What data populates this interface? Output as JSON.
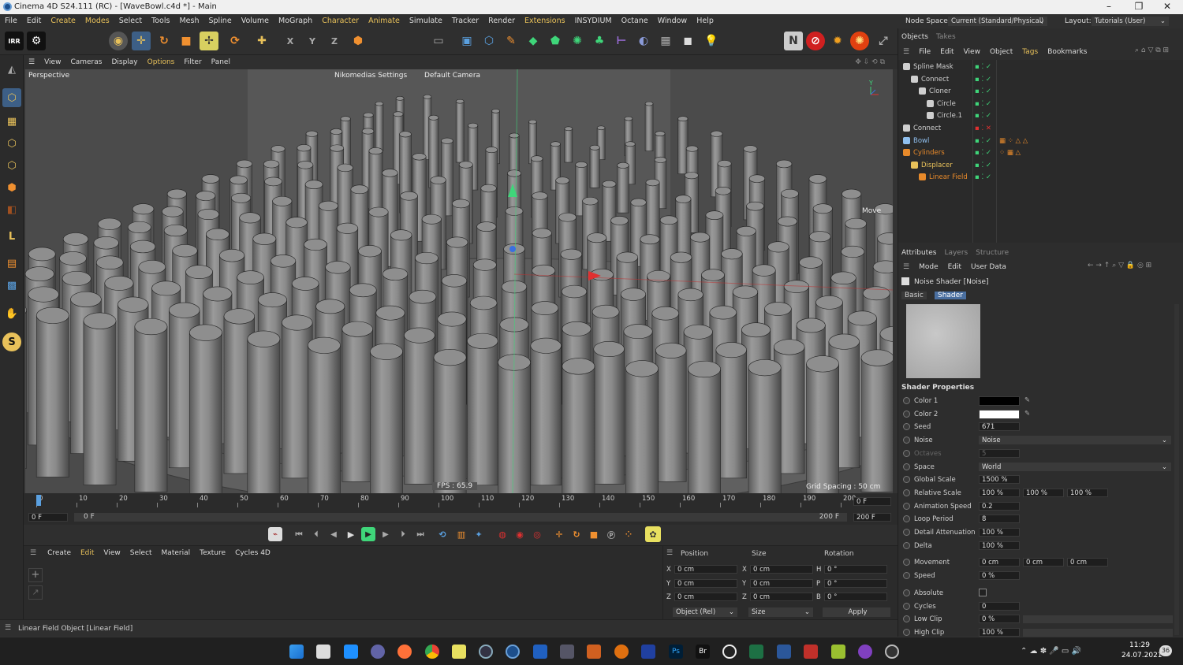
{
  "window": {
    "title": "Cinema 4D S24.111 (RC) - [WaveBowl.c4d *] - Main",
    "minimize": "–",
    "maximize": "❐",
    "close": "✕"
  },
  "menu": [
    "File",
    "Edit",
    "Create",
    "Modes",
    "Select",
    "Tools",
    "Mesh",
    "Spline",
    "Volume",
    "MoGraph",
    "Character",
    "Animate",
    "Simulate",
    "Tracker",
    "Render",
    "Extensions",
    "INSYDIUM",
    "Octane",
    "Window",
    "Help"
  ],
  "node_space": {
    "label": "Node Space:",
    "value": "Current (Standard/Physical)"
  },
  "layout": {
    "label": "Layout:",
    "value": "Tutorials (User)"
  },
  "viewport": {
    "menu": [
      "View",
      "Cameras",
      "Display",
      "Options",
      "Filter",
      "Panel"
    ],
    "name": "Perspective",
    "settings": "Nikomedias Settings",
    "camera": "Default Camera",
    "fps": "FPS : 65.9",
    "grid": "Grid Spacing : 50 cm",
    "move": "Move"
  },
  "timeline": {
    "ticks": [
      "0",
      "10",
      "20",
      "30",
      "40",
      "50",
      "60",
      "70",
      "80",
      "90",
      "100",
      "110",
      "120",
      "130",
      "140",
      "150",
      "160",
      "170",
      "180",
      "190",
      "200"
    ],
    "current": "0 F",
    "start": "0 F",
    "range_start": "0 F",
    "range_end": "200 F",
    "end": "200 F",
    "end2": "200 F"
  },
  "material_menu": [
    "Create",
    "Edit",
    "View",
    "Select",
    "Material",
    "Texture",
    "Cycles 4D"
  ],
  "coords": {
    "headers": [
      "Position",
      "Size",
      "Rotation"
    ],
    "rows": [
      {
        "axis": "X",
        "pos": "0 cm",
        "saxis": "X",
        "size": "0 cm",
        "raxis": "H",
        "rot": "0 °"
      },
      {
        "axis": "Y",
        "pos": "0 cm",
        "saxis": "Y",
        "size": "0 cm",
        "raxis": "P",
        "rot": "0 °"
      },
      {
        "axis": "Z",
        "pos": "0 cm",
        "saxis": "Z",
        "size": "0 cm",
        "raxis": "B",
        "rot": "0 °"
      }
    ],
    "mode": "Object (Rel)",
    "size_mode": "Size",
    "apply": "Apply"
  },
  "status": "Linear Field Object [Linear Field]",
  "objects_panel": {
    "tabs": [
      "Objects",
      "Takes"
    ],
    "menu": [
      "File",
      "Edit",
      "View",
      "Object",
      "Tags",
      "Bookmarks"
    ],
    "items": [
      {
        "name": "Spline Mask",
        "indent": 0,
        "color": "#cfcfcf",
        "icon": "spline-mask-icon"
      },
      {
        "name": "Connect",
        "indent": 1,
        "color": "#cfcfcf",
        "icon": "connect-icon"
      },
      {
        "name": "Cloner",
        "indent": 2,
        "color": "#cfcfcf",
        "icon": "cloner-icon"
      },
      {
        "name": "Circle",
        "indent": 3,
        "color": "#cfcfcf",
        "icon": "circle-spline-icon"
      },
      {
        "name": "Circle.1",
        "indent": 3,
        "color": "#cfcfcf",
        "icon": "circle-spline-icon"
      },
      {
        "name": "Connect",
        "indent": 0,
        "color": "#cfcfcf",
        "icon": "connect-icon"
      },
      {
        "name": "Bowl",
        "indent": 0,
        "color": "#8fbfee",
        "icon": "bowl-icon"
      },
      {
        "name": "Cylinders",
        "indent": 0,
        "color": "#e88a2a",
        "icon": "cylinders-icon"
      },
      {
        "name": "Displacer",
        "indent": 1,
        "color": "#e8c15a",
        "icon": "displacer-icon"
      },
      {
        "name": "Linear Field",
        "indent": 2,
        "color": "#e88a2a",
        "icon": "linear-field-icon"
      }
    ]
  },
  "attributes": {
    "tabs": [
      "Attributes",
      "Layers",
      "Structure"
    ],
    "menu": [
      "Mode",
      "Edit",
      "User Data"
    ],
    "object": "Noise Shader [Noise]",
    "subtabs": [
      "Basic",
      "Shader"
    ],
    "section": "Shader Properties",
    "rows": [
      {
        "label": "Color 1",
        "value": "",
        "kind": "color",
        "color": "#000000"
      },
      {
        "label": "Color 2",
        "value": "",
        "kind": "color",
        "color": "#ffffff"
      },
      {
        "label": "Seed",
        "value": "671",
        "kind": "num"
      },
      {
        "label": "Noise",
        "value": "Noise",
        "kind": "drop"
      },
      {
        "label": "Octaves",
        "value": "5",
        "kind": "num",
        "dim": true
      },
      {
        "label": "Space",
        "value": "World",
        "kind": "drop"
      },
      {
        "label": "Global Scale",
        "value": "1500 %",
        "kind": "num"
      },
      {
        "label": "Relative Scale",
        "value": "100 %",
        "v2": "100 %",
        "v3": "100 %",
        "kind": "tri"
      },
      {
        "label": "Animation Speed",
        "value": "0.2",
        "kind": "num"
      },
      {
        "label": "Loop Period",
        "value": "8",
        "kind": "num"
      },
      {
        "label": "Detail Attenuation",
        "value": "100 %",
        "kind": "num"
      },
      {
        "label": "Delta",
        "value": "100 %",
        "kind": "num"
      },
      {
        "label": "Movement",
        "value": "0 cm",
        "v2": "0 cm",
        "v3": "0 cm",
        "kind": "tri"
      },
      {
        "label": "Speed",
        "value": "0 %",
        "kind": "num"
      },
      {
        "label": "Absolute",
        "value": "",
        "kind": "check"
      },
      {
        "label": "Cycles",
        "value": "0",
        "kind": "num"
      },
      {
        "label": "Low Clip",
        "value": "0 %",
        "kind": "slider"
      },
      {
        "label": "High Clip",
        "value": "100 %",
        "kind": "slider"
      }
    ]
  },
  "taskbar": {
    "time": "11:29",
    "date": "24.07.2021",
    "badge": "36"
  }
}
